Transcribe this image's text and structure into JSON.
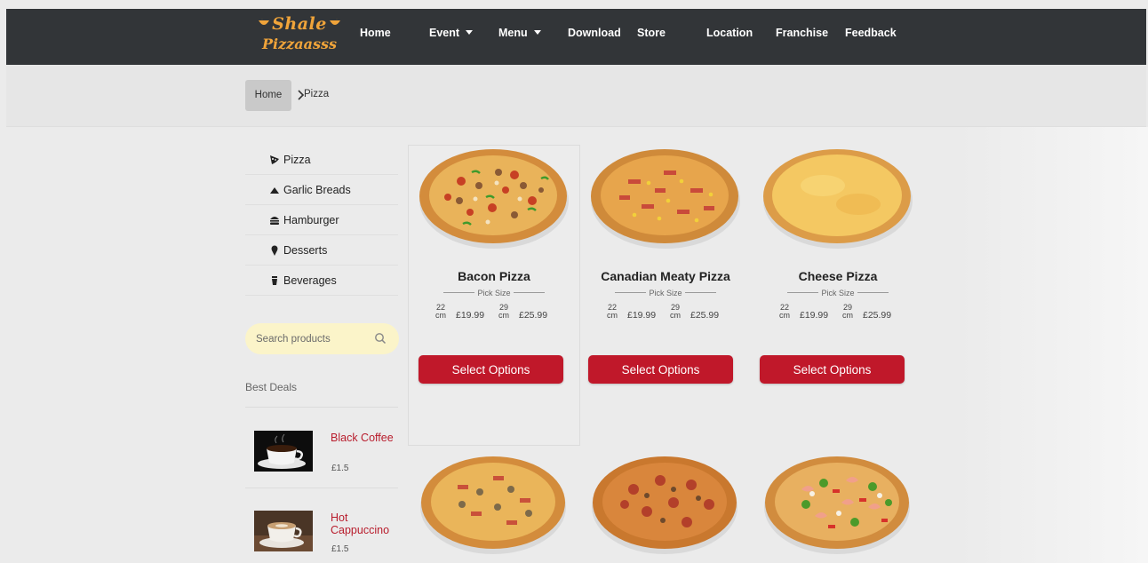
{
  "brand": {
    "line1": "Shale",
    "line2": "Pizzaasss"
  },
  "nav": {
    "home": "Home",
    "event": "Event",
    "menu": "Menu",
    "download": "Download",
    "store": "Store",
    "location": "Location",
    "franchise": "Franchise",
    "feedback": "Feedback"
  },
  "breadcrumb": {
    "home": "Home",
    "current": "Pizza"
  },
  "categories": [
    {
      "label": "Pizza",
      "icon": "pizza-slice-icon"
    },
    {
      "label": "Garlic Breads",
      "icon": "bread-icon"
    },
    {
      "label": "Hamburger",
      "icon": "hamburger-icon"
    },
    {
      "label": "Desserts",
      "icon": "ice-cream-icon"
    },
    {
      "label": "Beverages",
      "icon": "drink-cup-icon"
    }
  ],
  "search": {
    "placeholder": "Search products",
    "icon": "search-icon"
  },
  "best_deals": {
    "title": "Best Deals",
    "items": [
      {
        "name": "Black Coffee",
        "price": "£1.5"
      },
      {
        "name": "Hot Cappuccino",
        "price": "£1.5"
      }
    ]
  },
  "products": [
    {
      "name": "Bacon Pizza",
      "pick_size": "Pick Size",
      "size_small": "22",
      "size_large": "29",
      "unit": "cm",
      "price_small": "£19.99",
      "price_large": "£25.99",
      "button": "Select Options"
    },
    {
      "name": "Canadian Meaty Pizza",
      "pick_size": "Pick Size",
      "size_small": "22",
      "size_large": "29",
      "unit": "cm",
      "price_small": "£19.99",
      "price_large": "£25.99",
      "button": "Select Options"
    },
    {
      "name": "Cheese Pizza",
      "pick_size": "Pick Size",
      "size_small": "22",
      "size_large": "29",
      "unit": "cm",
      "price_small": "£19.99",
      "price_large": "£25.99",
      "button": "Select Options"
    }
  ],
  "colors": {
    "navbar": "#323538",
    "accent_red": "#c0182a",
    "brand_orange": "#f0a43a",
    "search_bg": "#fbf4c9",
    "deal_name": "#b81c2c"
  }
}
